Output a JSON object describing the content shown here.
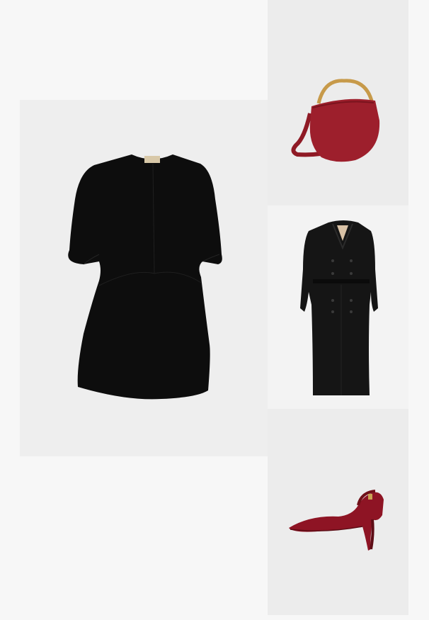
{
  "outfit": {
    "items": [
      {
        "name": "dress",
        "icon": "black-dress-image",
        "color": "#0e0e0e"
      },
      {
        "name": "bag",
        "icon": "red-handbag-image",
        "color": "#9d1f2c"
      },
      {
        "name": "coat",
        "icon": "black-trench-coat-image",
        "color": "#151515"
      },
      {
        "name": "shoe",
        "icon": "red-slingback-pump-image",
        "color": "#8e1424"
      }
    ],
    "background": "#f7f7f7"
  }
}
